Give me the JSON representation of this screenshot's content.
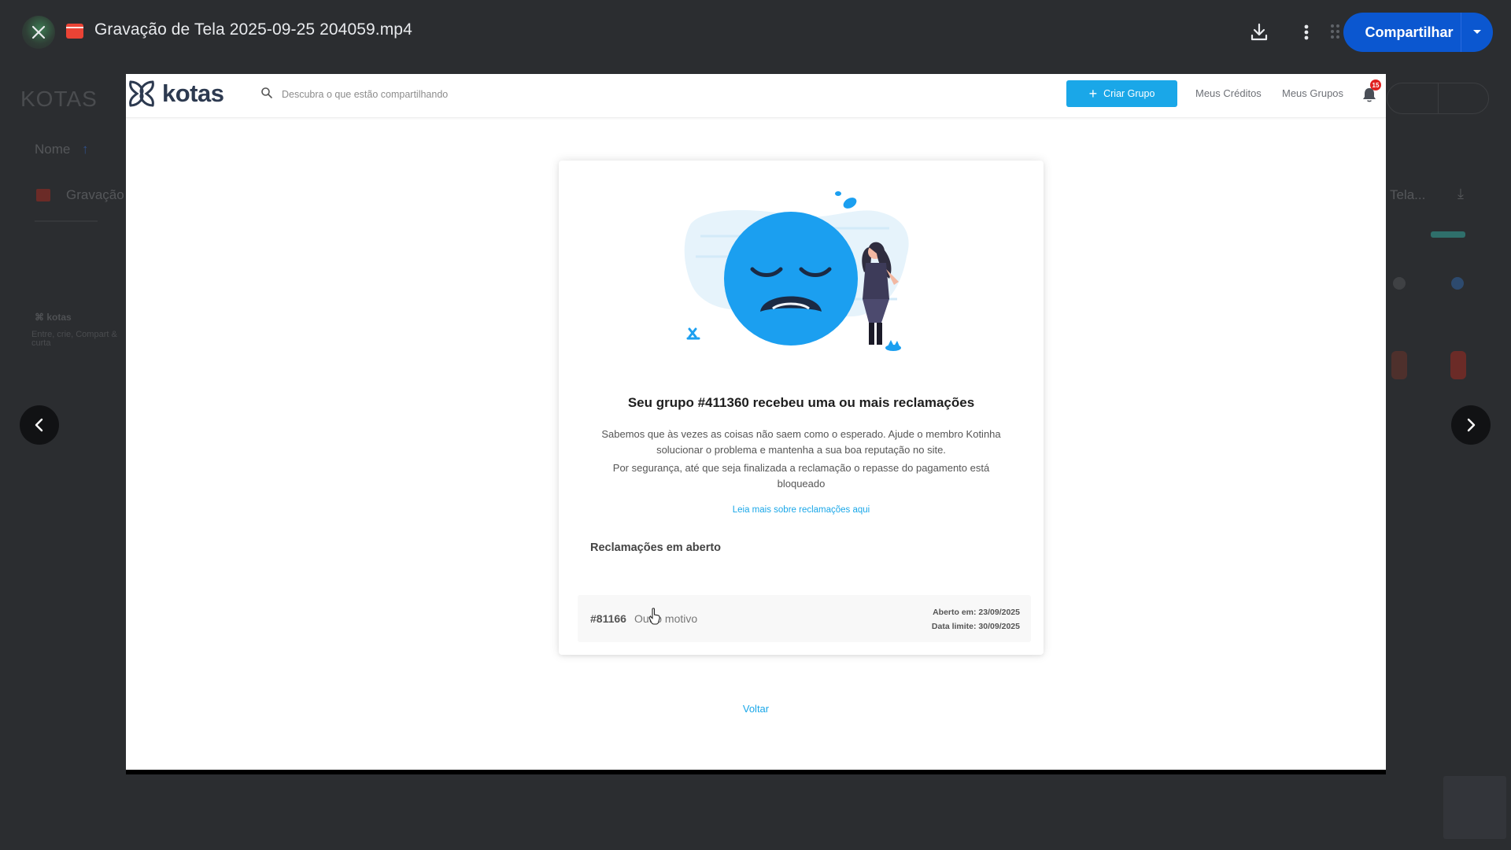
{
  "viewer": {
    "file_title": "Gravação de Tela 2025-09-25 204059.mp4",
    "share_label": "Compartilhar"
  },
  "background": {
    "folder_title": "KOTAS",
    "sort_label": "Nome",
    "row_name": "Gravação",
    "row_name_right": "Tela...",
    "logo_text": "kotas",
    "tagline": "Entre, crie, Compart & curta"
  },
  "site": {
    "logo_text": "kotas",
    "search_placeholder": "Descubra o que estão compartilhando",
    "create_group_label": "Criar Grupo",
    "nav_credits": "Meus Créditos",
    "nav_groups": "Meus Grupos",
    "notification_count": "15",
    "card": {
      "title": "Seu grupo #411360 recebeu uma ou mais reclamações",
      "paragraph1": "Sabemos que às vezes as coisas não saem como o esperado. Ajude o membro Kotinha solucionar o problema e mantenha a sua boa reputação no site.",
      "paragraph2": "Por segurança, até que seja finalizada a reclamação o repasse do pagamento está bloqueado",
      "link": "Leia mais sobre reclamações aqui",
      "complaints_heading": "Reclamações em aberto",
      "complaints": [
        {
          "id": "#81166",
          "reason": "Outro motivo",
          "opened": "Aberto em: 23/09/2025",
          "deadline": "Data limite: 30/09/2025"
        }
      ]
    },
    "back_label": "Voltar"
  },
  "colors": {
    "brand_blue": "#1aa7e8",
    "share_blue": "#0b57d0",
    "face_blue": "#1b9ff0"
  }
}
